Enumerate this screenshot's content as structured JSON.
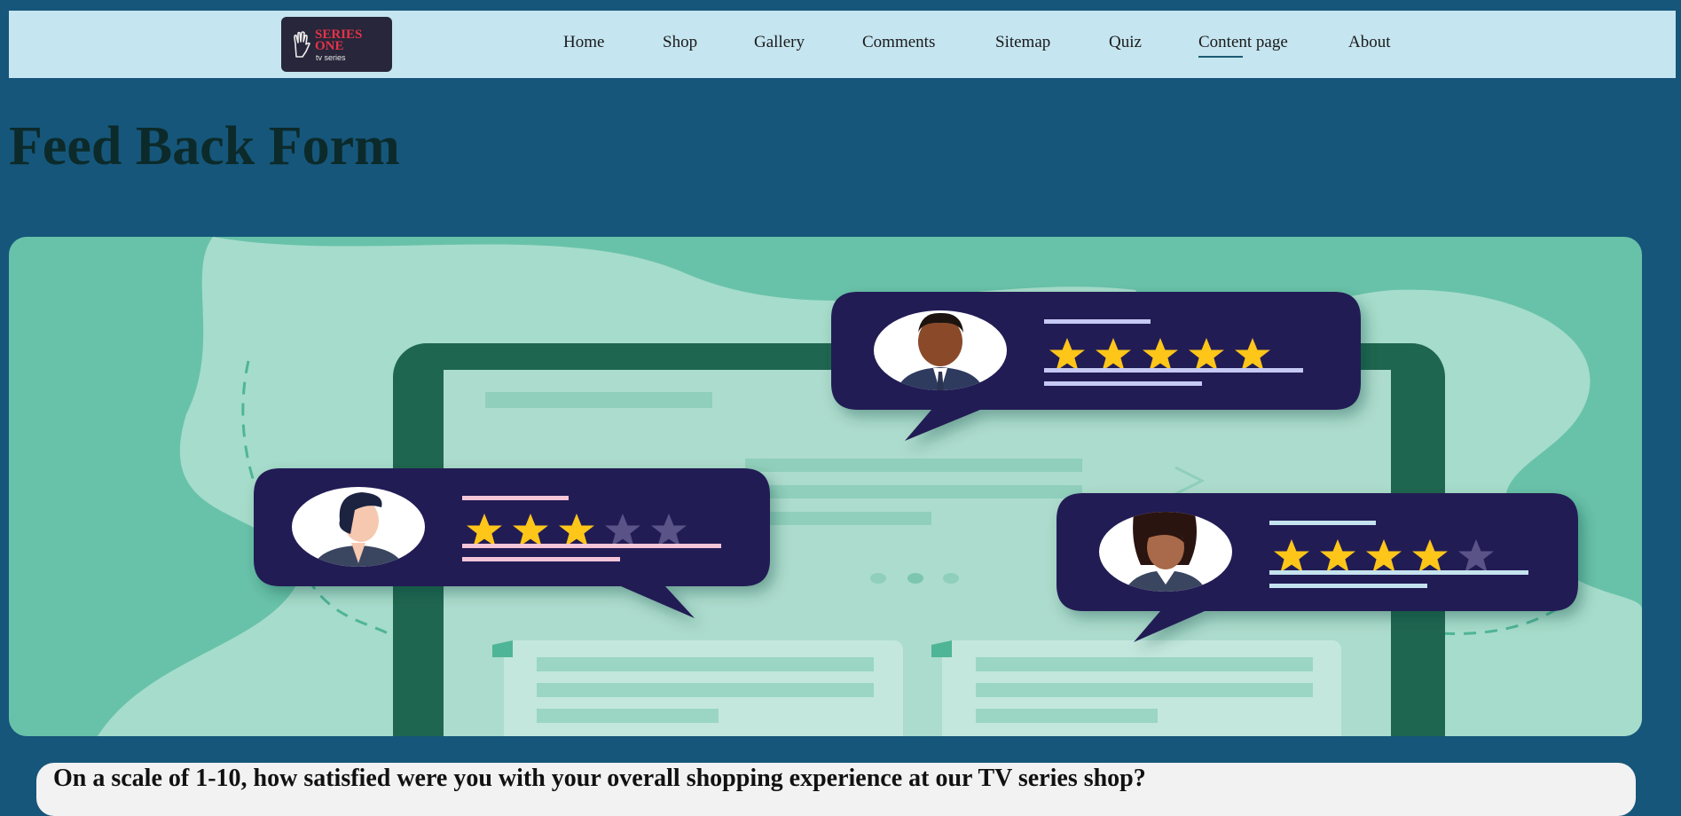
{
  "brand": {
    "logo_line1": "SERIES",
    "logo_line2": "ONE",
    "logo_line3": "tv series",
    "logo_bg": "#27263a",
    "logo_accent": "#e63348"
  },
  "nav": {
    "items": [
      {
        "label": "Home"
      },
      {
        "label": "Shop"
      },
      {
        "label": "Gallery"
      },
      {
        "label": "Comments"
      },
      {
        "label": "Sitemap"
      },
      {
        "label": "Quiz"
      },
      {
        "label": "Content page",
        "active": true
      },
      {
        "label": "About"
      }
    ]
  },
  "page": {
    "title": "Feed Back Form"
  },
  "hero": {
    "reviews": [
      {
        "person": "man-in-suit",
        "stars": 5
      },
      {
        "person": "woman-short-hair",
        "stars": 3
      },
      {
        "person": "woman-long-hair",
        "stars": 4
      }
    ]
  },
  "form": {
    "question": "On a scale of 1-10, how satisfied were you with your overall shopping experience at our TV series shop?"
  },
  "colors": {
    "page_bg": "#16567a",
    "nav_bg": "#c5e5f0",
    "hero_bg": "#68c2a9",
    "bubble": "#221b55",
    "star_on": "#ffc61a",
    "star_off": "#5a5387"
  }
}
